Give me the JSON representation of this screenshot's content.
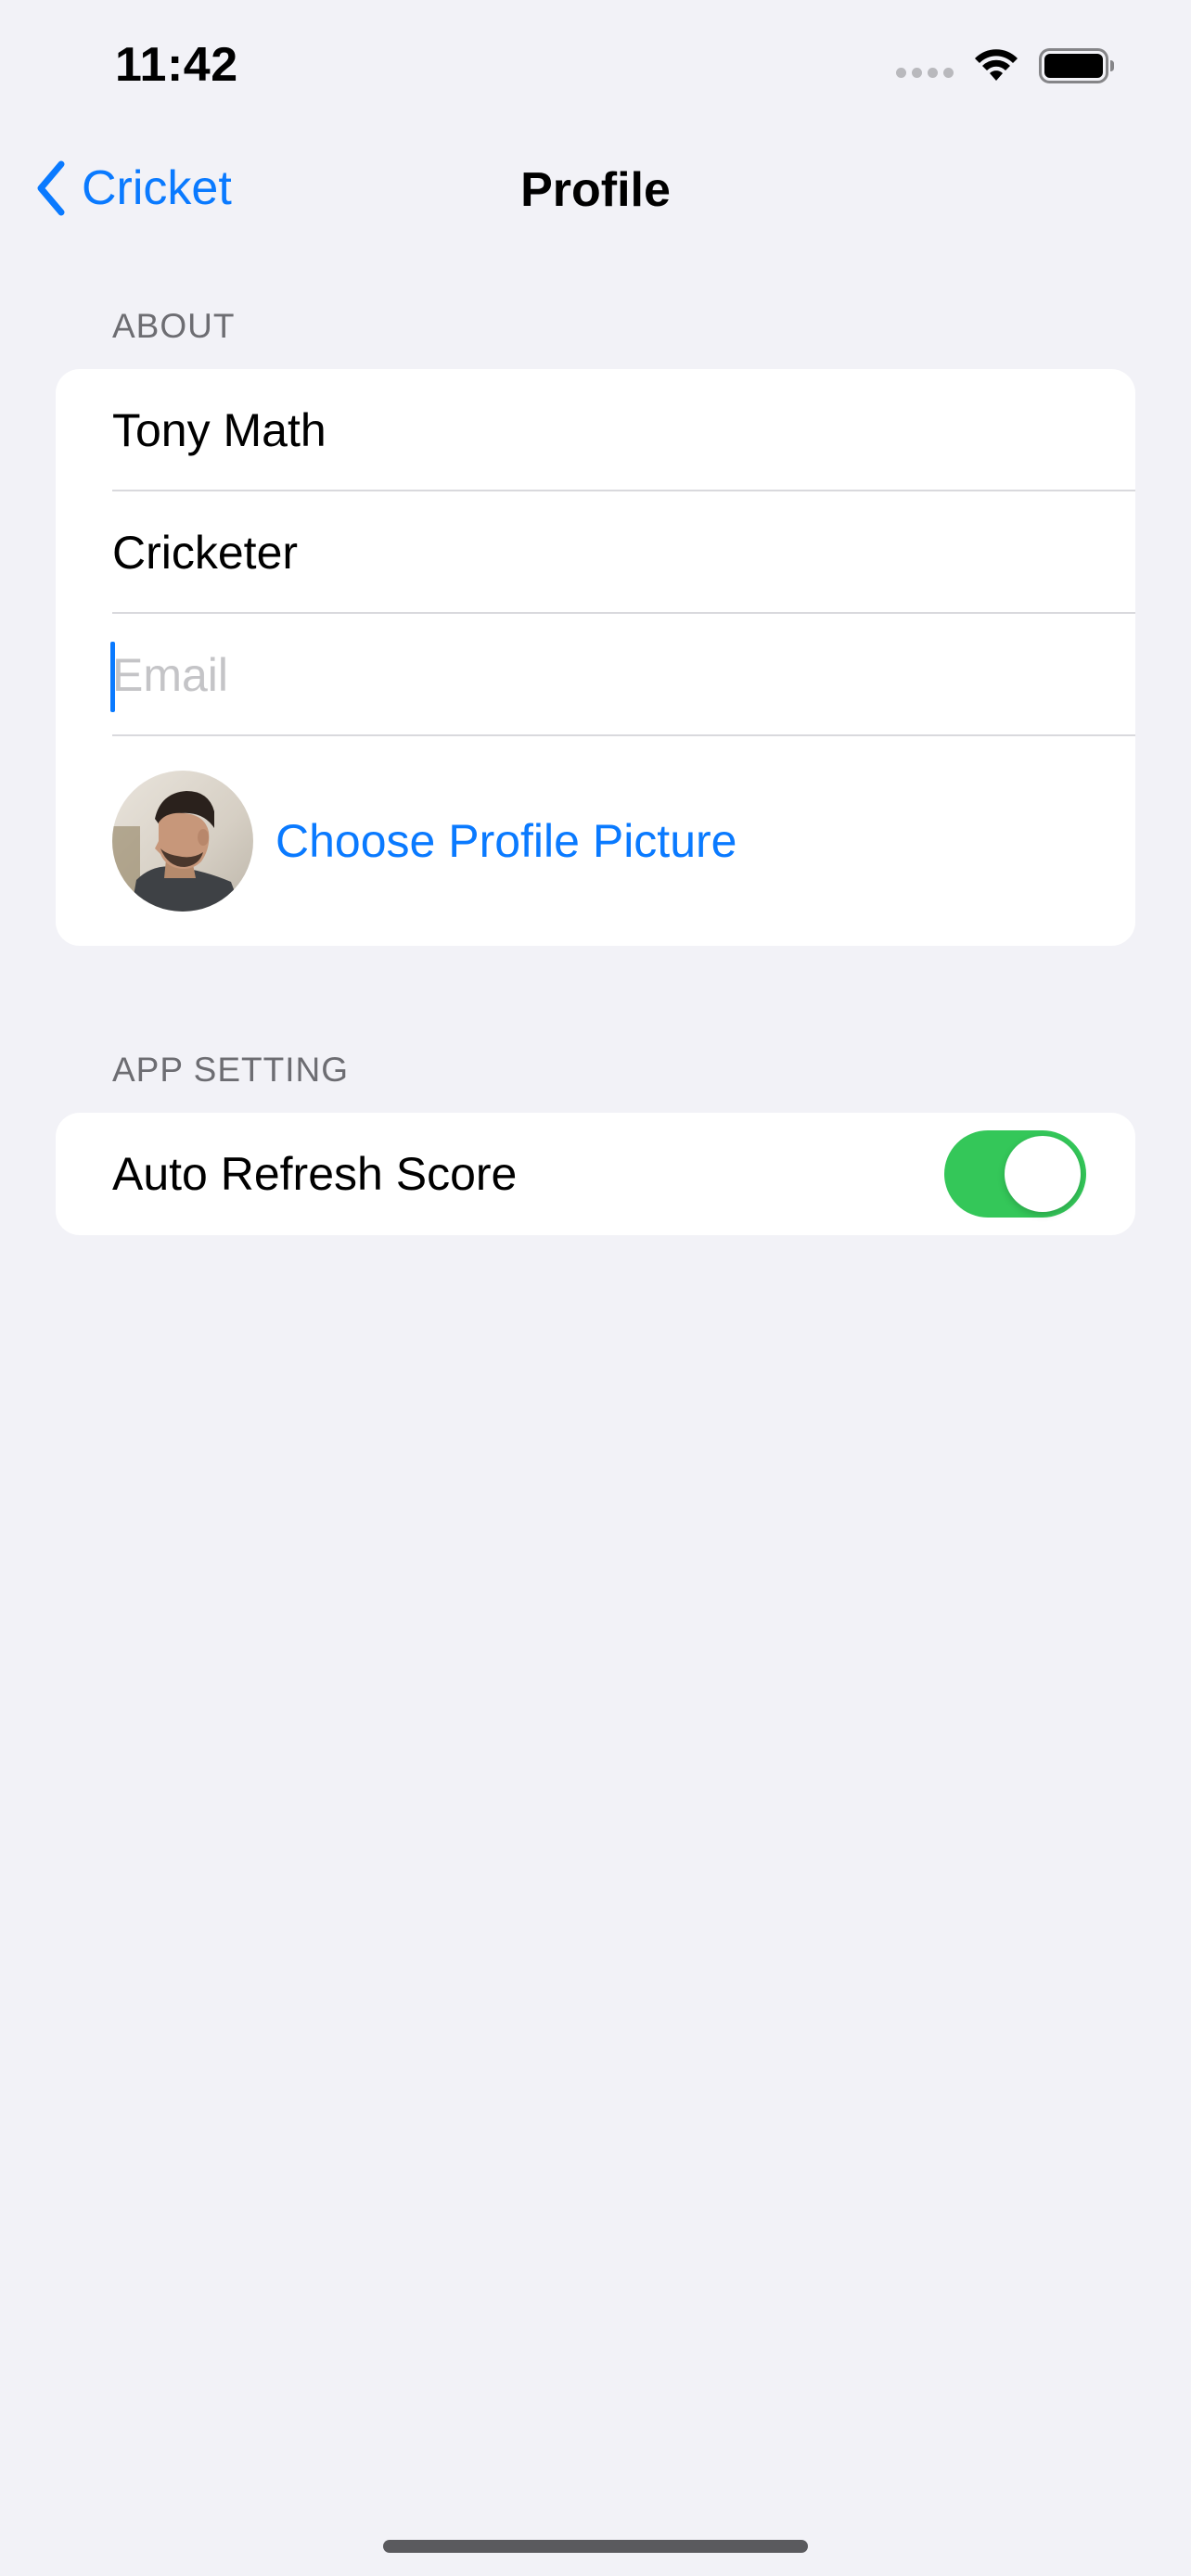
{
  "status_bar": {
    "time": "11:42",
    "icons": [
      "cellular-signal-icon",
      "wifi-icon",
      "battery-icon"
    ]
  },
  "nav": {
    "back_label": "Cricket",
    "back_icon": "chevron-left-icon",
    "title": "Profile"
  },
  "about": {
    "header": "ABOUT",
    "name": "Tony Math",
    "role": "Cricketer",
    "email_value": "",
    "email_placeholder": "Email",
    "choose_picture_label": "Choose Profile Picture"
  },
  "app_setting": {
    "header": "APP SETTING",
    "auto_refresh_label": "Auto Refresh Score",
    "auto_refresh_on": true
  },
  "colors": {
    "accent": "#0a7aff",
    "toggle_on": "#34c759",
    "background": "#f2f2f7",
    "section_header": "#6d6d72"
  }
}
